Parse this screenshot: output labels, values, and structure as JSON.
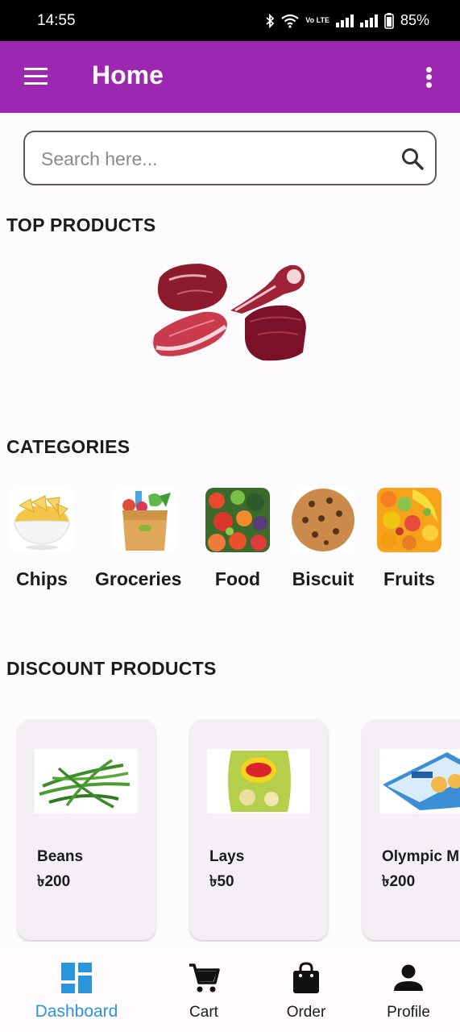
{
  "status_bar": {
    "time": "14:55",
    "battery": "85%",
    "network_label": "Vo LTE"
  },
  "app_bar": {
    "title": "Home",
    "menu_icon": "hamburger-menu-icon",
    "more_icon": "more-vertical-icon"
  },
  "search": {
    "placeholder": "Search here...",
    "value": ""
  },
  "sections": {
    "top_products": "TOP PRODUCTS",
    "categories": "CATEGORIES",
    "discount_products": "DISCOUNT PRODUCTS"
  },
  "categories": [
    {
      "label": "Chips"
    },
    {
      "label": "Groceries"
    },
    {
      "label": "Food"
    },
    {
      "label": "Biscuit"
    },
    {
      "label": "Fruits"
    }
  ],
  "products": [
    {
      "name": "Beans",
      "price": "৳200"
    },
    {
      "name": "Lays",
      "price": "৳50"
    },
    {
      "name": "Olympic Mi",
      "price": "৳200"
    }
  ],
  "bottom_nav": [
    {
      "label": "Dashboard",
      "icon": "dashboard-icon",
      "active": true
    },
    {
      "label": "Cart",
      "icon": "cart-icon"
    },
    {
      "label": "Order",
      "icon": "shopping-bag-icon"
    },
    {
      "label": "Profile",
      "icon": "person-icon"
    }
  ],
  "colors": {
    "app_bar": "#9c27b0",
    "active_nav": "#2a95dc",
    "card_bg": "#f4eff5"
  }
}
